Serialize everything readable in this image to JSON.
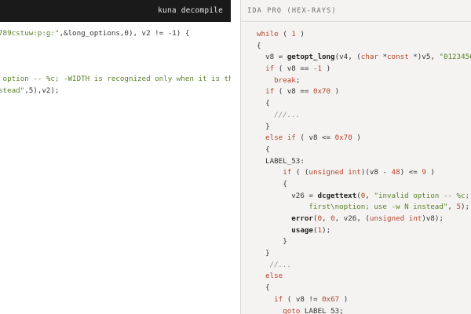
{
  "left_panel": {
    "header_label": "kuna decompile",
    "lines": [
      {
        "parts": [
          {
            "t": "789cstuw:p:g:\"",
            "c": "str"
          },
          {
            "t": ",&long_options,0), v2 != -1) {",
            "c": "plain"
          }
        ]
      },
      {
        "parts": [
          {
            "t": "",
            "c": "plain"
          }
        ]
      },
      {
        "parts": [
          {
            "t": "",
            "c": "plain"
          }
        ]
      },
      {
        "parts": [
          {
            "t": "",
            "c": "plain"
          }
        ]
      },
      {
        "parts": [
          {
            "t": " option -- %c; -WIDTH is recognized only when it is the",
            "c": "str"
          }
        ]
      },
      {
        "parts": [
          {
            "t": "stead\"",
            "c": "str"
          },
          {
            "t": ",5),v2);",
            "c": "plain"
          }
        ]
      }
    ]
  },
  "right_panel": {
    "header_label": "IDA PRO (HEX-RAYS)",
    "lines": [
      {
        "parts": [
          {
            "t": "while",
            "c": "kw"
          },
          {
            "t": " ( ",
            "c": "plain"
          },
          {
            "t": "1",
            "c": "num"
          },
          {
            "t": " )",
            "c": "plain"
          }
        ]
      },
      {
        "parts": [
          {
            "t": "{",
            "c": "plain"
          }
        ]
      },
      {
        "parts": [
          {
            "t": "  v8 = ",
            "c": "plain"
          },
          {
            "t": "getopt_long",
            "c": "fn"
          },
          {
            "t": "(v4, (",
            "c": "plain"
          },
          {
            "t": "char",
            "c": "ty"
          },
          {
            "t": " *",
            "c": "plain"
          },
          {
            "t": "const",
            "c": "ty"
          },
          {
            "t": " *)v5, ",
            "c": "plain"
          },
          {
            "t": "\"0123456789a",
            "c": "str"
          }
        ]
      },
      {
        "parts": [
          {
            "t": "  ",
            "c": "plain"
          },
          {
            "t": "if",
            "c": "kw"
          },
          {
            "t": " ( v8 == ",
            "c": "plain"
          },
          {
            "t": "-1",
            "c": "num"
          },
          {
            "t": " )",
            "c": "plain"
          }
        ]
      },
      {
        "parts": [
          {
            "t": "    ",
            "c": "plain"
          },
          {
            "t": "break",
            "c": "kw"
          },
          {
            "t": ";",
            "c": "plain"
          }
        ]
      },
      {
        "parts": [
          {
            "t": "  ",
            "c": "plain"
          },
          {
            "t": "if",
            "c": "kw"
          },
          {
            "t": " ( v8 == ",
            "c": "plain"
          },
          {
            "t": "0x70",
            "c": "num"
          },
          {
            "t": " )",
            "c": "plain"
          }
        ]
      },
      {
        "parts": [
          {
            "t": "  {",
            "c": "plain"
          }
        ]
      },
      {
        "parts": [
          {
            "t": "    ///...",
            "c": "cmt"
          }
        ]
      },
      {
        "parts": [
          {
            "t": "  }",
            "c": "plain"
          }
        ]
      },
      {
        "parts": [
          {
            "t": "  ",
            "c": "plain"
          },
          {
            "t": "else if",
            "c": "kw"
          },
          {
            "t": " ( v8 <= ",
            "c": "plain"
          },
          {
            "t": "0x70",
            "c": "num"
          },
          {
            "t": " )",
            "c": "plain"
          }
        ]
      },
      {
        "parts": [
          {
            "t": "  {",
            "c": "plain"
          }
        ]
      },
      {
        "parts": [
          {
            "t": "  LABEL_53:",
            "c": "plain"
          }
        ]
      },
      {
        "parts": [
          {
            "t": "      ",
            "c": "plain"
          },
          {
            "t": "if",
            "c": "kw"
          },
          {
            "t": " ( (",
            "c": "plain"
          },
          {
            "t": "unsigned int",
            "c": "ty"
          },
          {
            "t": ")(v8 - ",
            "c": "plain"
          },
          {
            "t": "48",
            "c": "num"
          },
          {
            "t": ") <= ",
            "c": "plain"
          },
          {
            "t": "9",
            "c": "num"
          },
          {
            "t": " )",
            "c": "plain"
          }
        ]
      },
      {
        "parts": [
          {
            "t": "      {",
            "c": "plain"
          }
        ]
      },
      {
        "parts": [
          {
            "t": "        v26 = ",
            "c": "plain"
          },
          {
            "t": "dcgettext",
            "c": "fn"
          },
          {
            "t": "(",
            "c": "plain"
          },
          {
            "t": "0",
            "c": "num"
          },
          {
            "t": ", ",
            "c": "plain"
          },
          {
            "t": "\"invalid option -- %c; -WIDT",
            "c": "str"
          }
        ]
      },
      {
        "parts": [
          {
            "t": "            first\\noption; use -w N instead\"",
            "c": "str"
          },
          {
            "t": ", ",
            "c": "plain"
          },
          {
            "t": "5",
            "c": "num"
          },
          {
            "t": ");",
            "c": "plain"
          }
        ]
      },
      {
        "parts": [
          {
            "t": "        ",
            "c": "plain"
          },
          {
            "t": "error",
            "c": "fn"
          },
          {
            "t": "(",
            "c": "plain"
          },
          {
            "t": "0",
            "c": "num"
          },
          {
            "t": ", ",
            "c": "plain"
          },
          {
            "t": "0",
            "c": "num"
          },
          {
            "t": ", v26, (",
            "c": "plain"
          },
          {
            "t": "unsigned int",
            "c": "ty"
          },
          {
            "t": ")v8);",
            "c": "plain"
          }
        ]
      },
      {
        "parts": [
          {
            "t": "        ",
            "c": "plain"
          },
          {
            "t": "usage",
            "c": "fn"
          },
          {
            "t": "(",
            "c": "plain"
          },
          {
            "t": "1",
            "c": "num"
          },
          {
            "t": ");",
            "c": "plain"
          }
        ]
      },
      {
        "parts": [
          {
            "t": "      }",
            "c": "plain"
          }
        ]
      },
      {
        "parts": [
          {
            "t": "  }",
            "c": "plain"
          }
        ]
      },
      {
        "parts": [
          {
            "t": "   //...",
            "c": "cmt"
          }
        ]
      },
      {
        "parts": [
          {
            "t": "  ",
            "c": "plain"
          },
          {
            "t": "else",
            "c": "kw"
          }
        ]
      },
      {
        "parts": [
          {
            "t": "  {",
            "c": "plain"
          }
        ]
      },
      {
        "parts": [
          {
            "t": "    ",
            "c": "plain"
          },
          {
            "t": "if",
            "c": "kw"
          },
          {
            "t": " ( v8 != ",
            "c": "plain"
          },
          {
            "t": "0x67",
            "c": "num"
          },
          {
            "t": " )",
            "c": "plain"
          }
        ]
      },
      {
        "parts": [
          {
            "t": "      ",
            "c": "plain"
          },
          {
            "t": "goto",
            "c": "kw"
          },
          {
            "t": " LABEL_53;",
            "c": "plain"
          }
        ]
      }
    ]
  }
}
